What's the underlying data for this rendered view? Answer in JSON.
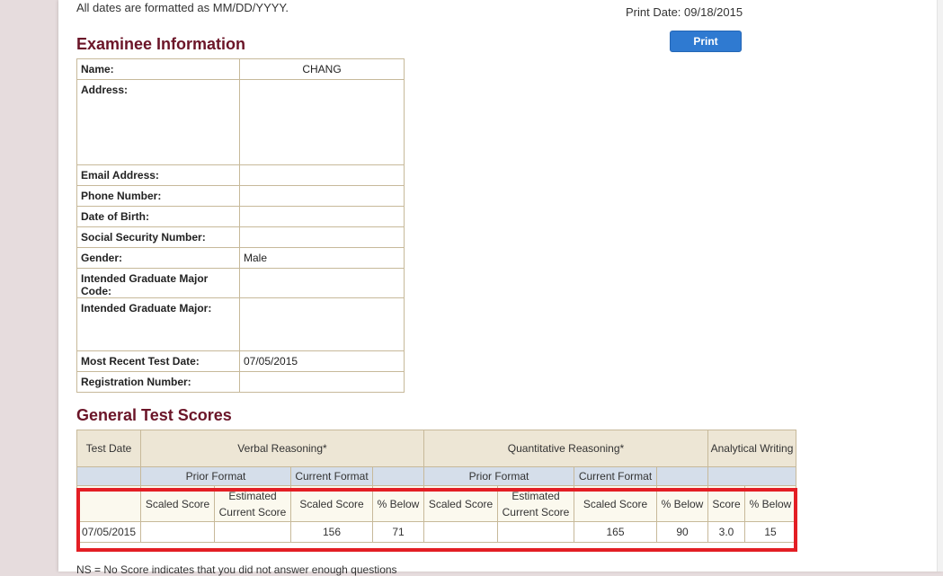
{
  "header": {
    "date_format_note": "All dates are formatted as MM/DD/YYYY.",
    "print_date": "Print Date: 09/18/2015",
    "print_button": "Print"
  },
  "examinee": {
    "title": "Examinee Information",
    "rows": [
      {
        "label": "Name:",
        "value": "CHANG"
      },
      {
        "label": "Address:",
        "value": ""
      },
      {
        "label": "Email Address:",
        "value": ""
      },
      {
        "label": "Phone Number:",
        "value": ""
      },
      {
        "label": "Date of Birth:",
        "value": ""
      },
      {
        "label": "Social Security Number:",
        "value": ""
      },
      {
        "label": "Gender:",
        "value": "Male"
      },
      {
        "label": "Intended Graduate Major Code:",
        "value": ""
      },
      {
        "label": "Intended Graduate Major:",
        "value": ""
      },
      {
        "label": "Most Recent Test Date:",
        "value": "07/05/2015"
      },
      {
        "label": "Registration Number:",
        "value": ""
      }
    ]
  },
  "scores": {
    "title": "General Test Scores",
    "header": {
      "test_date": "Test Date",
      "verbal": "Verbal Reasoning*",
      "quant": "Quantitative Reasoning*",
      "writing": "Analytical Writing"
    },
    "format_row": {
      "v_prior": "Prior Format",
      "v_current": "Current Format",
      "q_prior": "Prior Format",
      "q_current": "Current Format"
    },
    "columns": [
      "Scaled Score",
      "Estimated Current Score",
      "Scaled Score",
      "% Below",
      "Scaled Score",
      "Estimated Current Score",
      "Scaled Score",
      "% Below",
      "Score",
      "% Below"
    ],
    "data_row": {
      "test_date": "07/05/2015",
      "cells": [
        "",
        "",
        "156",
        "71",
        "",
        "",
        "165",
        "90",
        "3.0",
        "15"
      ]
    }
  },
  "footnote": "NS = No Score indicates that you did not answer enough questions"
}
